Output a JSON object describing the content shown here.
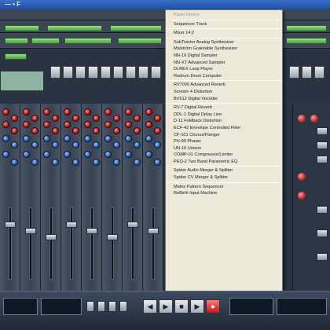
{
  "window": {
    "title": "— • F",
    "title_bar_color": "#2a5bb8"
  },
  "context_menu": {
    "items": [
      {
        "label": "Paste Device",
        "disabled": true
      },
      {
        "separator": true
      },
      {
        "label": "Sequencer Track"
      },
      {
        "separator": true
      },
      {
        "label": "Mixer 14:2"
      },
      {
        "separator": true
      },
      {
        "label": "SubTractor Analog Synthesizer"
      },
      {
        "label": "Malström Graintable Synthesizer"
      },
      {
        "label": "NN-19 Digital Sampler"
      },
      {
        "label": "NN-XT Advanced Sampler"
      },
      {
        "label": "Dr.REX Loop Player"
      },
      {
        "label": "Redrum Drum Computer"
      },
      {
        "separator": true
      },
      {
        "label": "RV7000 Advanced Reverb"
      },
      {
        "label": "Scream 4 Distortion"
      },
      {
        "label": "BV512 Digital Vocoder"
      },
      {
        "separator": true
      },
      {
        "label": "RV-7 Digital Reverb"
      },
      {
        "label": "DDL-1 Digital Delay Line"
      },
      {
        "label": "D-11 Foldback Distortion"
      },
      {
        "label": "ECF-42 Envelope Controlled Filter"
      },
      {
        "label": "CF-101 Chorus/Flanger"
      },
      {
        "label": "PH-90 Phaser"
      },
      {
        "label": "UN-16 Unison"
      },
      {
        "label": "COMP-01 Compressor/Limiter"
      },
      {
        "label": "PEQ-2 Two Band Parametric EQ"
      },
      {
        "separator": true
      },
      {
        "label": "Spider Audio Merger & Splitter"
      },
      {
        "label": "Spider CV Merger & Splitter"
      },
      {
        "separator": true
      },
      {
        "label": "Matrix Pattern Sequencer"
      },
      {
        "label": "ReBirth Input Machine"
      }
    ]
  },
  "transport": {
    "play_glyph": "▶",
    "stop_glyph": "■",
    "rew_glyph": "◀",
    "ff_glyph": "▶",
    "rec_glyph": "●"
  },
  "colors": {
    "accent_green": "#6cc35f",
    "knob_red": "#c0262b",
    "rec_red": "#d81e1e",
    "menu_bg": "#ece9d8"
  }
}
